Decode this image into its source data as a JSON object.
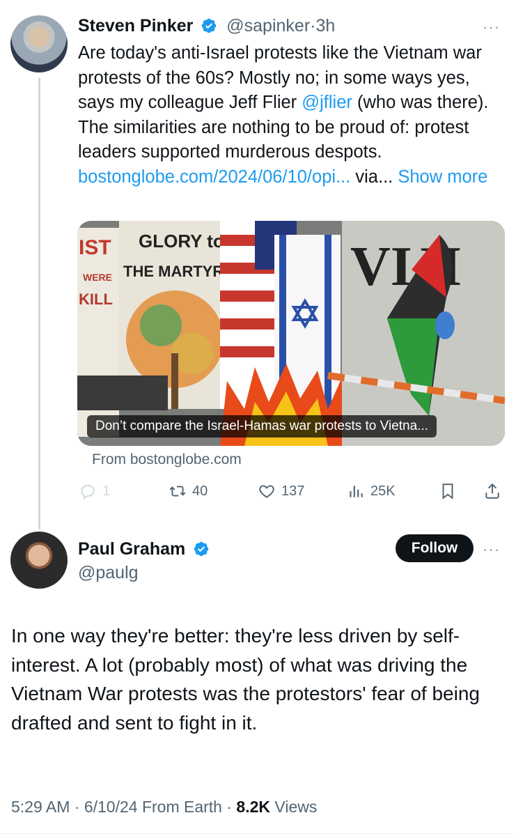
{
  "tweet1": {
    "author_name": "Steven Pinker",
    "handle": "@sapinker",
    "dot": "·",
    "time": "3h",
    "more": "···",
    "text_part1": "Are today's anti-Israel protests like the Vietnam war protests of the 60s?  Mostly no; in some ways yes, says my colleague Jeff Flier ",
    "mention": "@jflier",
    "text_part2": " (who was there). The similarities are nothing to be proud of: protest leaders supported murderous despots. ",
    "url": "bostonglobe.com/2024/06/10/opi...",
    "via": " via... ",
    "show_more": "Show more",
    "card_caption": "Don’t compare the Israel-Hamas war protests to Vietna...",
    "card_source": "From bostonglobe.com",
    "replies": "1",
    "reposts": "40",
    "likes": "137",
    "views": "25K"
  },
  "tweet2": {
    "author_name": "Paul Graham",
    "handle": "@paulg",
    "follow_label": "Follow",
    "more": "···",
    "text": "In one way they're better: they're less driven by self-interest. A lot (probably most) of what was driving the Vietnam War protests was the protestors' fear of being drafted and sent to fight in it.",
    "timestamp": "5:29 AM · 6/10/24 From Earth · ",
    "views_count": "8.2K",
    "views_label": " Views"
  },
  "colors": {
    "accent": "#1d9bf0",
    "text": "#0f1419",
    "muted": "#536471"
  },
  "icons": [
    "verified-badge-icon",
    "more-icon",
    "reply-icon",
    "repost-icon",
    "like-icon",
    "views-icon",
    "bookmark-icon",
    "share-icon"
  ]
}
